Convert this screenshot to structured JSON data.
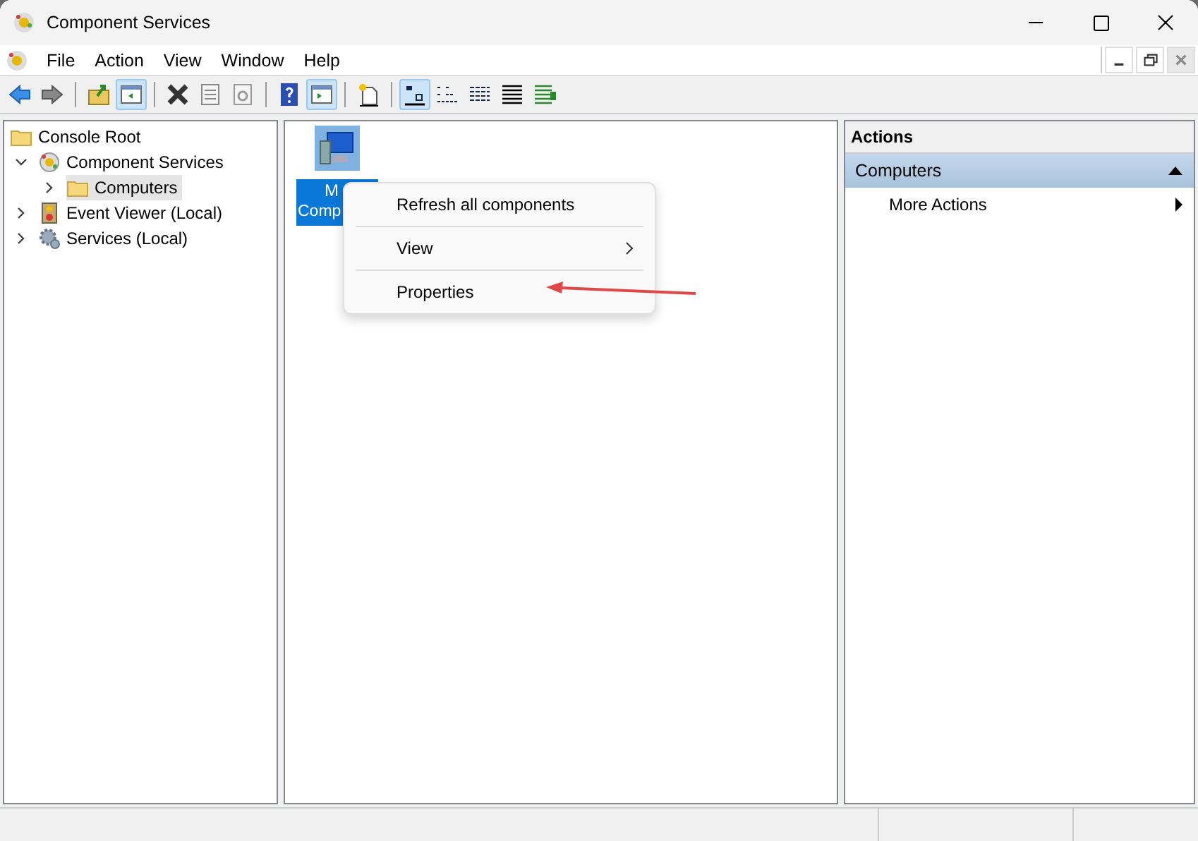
{
  "window": {
    "title": "Component Services"
  },
  "menu_bar": [
    "File",
    "Action",
    "View",
    "Window",
    "Help"
  ],
  "toolbar": [
    {
      "kind": "back",
      "pressed": false
    },
    {
      "kind": "forward",
      "pressed": false
    },
    {
      "kind": "sep"
    },
    {
      "kind": "up",
      "pressed": false
    },
    {
      "kind": "tree",
      "pressed": true
    },
    {
      "kind": "sep"
    },
    {
      "kind": "delete",
      "pressed": false
    },
    {
      "kind": "properties",
      "pressed": false
    },
    {
      "kind": "refresh",
      "pressed": false
    },
    {
      "kind": "sep"
    },
    {
      "kind": "help",
      "pressed": false
    },
    {
      "kind": "actionpane",
      "pressed": true
    },
    {
      "kind": "sep"
    },
    {
      "kind": "newwindow",
      "pressed": false
    },
    {
      "kind": "sep"
    },
    {
      "kind": "largeicons",
      "pressed": true
    },
    {
      "kind": "smallicons",
      "pressed": false
    },
    {
      "kind": "list",
      "pressed": false
    },
    {
      "kind": "details",
      "pressed": false
    },
    {
      "kind": "export",
      "pressed": false
    }
  ],
  "tree": [
    {
      "label": "Console Root",
      "kind": "folder",
      "selected": false,
      "children": [
        {
          "label": "Component Services",
          "kind": "component",
          "expanded": true,
          "selected": false,
          "children": [
            {
              "label": "Computers",
              "kind": "folder",
              "expanded": false,
              "selected": true
            }
          ]
        },
        {
          "label": "Event Viewer (Local)",
          "kind": "event",
          "expanded": false,
          "selected": false
        },
        {
          "label": "Services (Local)",
          "kind": "services",
          "expanded": false,
          "selected": false
        }
      ]
    }
  ],
  "content": {
    "items": [
      {
        "label_lines": [
          "M",
          "Comp"
        ],
        "selected": true
      }
    ]
  },
  "context_menu": [
    {
      "label": "Refresh all components",
      "submenu": false
    },
    {
      "label": "View",
      "submenu": true
    },
    {
      "label": "Properties",
      "submenu": false
    }
  ],
  "actions": {
    "title": "Actions",
    "sections": [
      {
        "title": "Computers",
        "expanded": true,
        "items": [
          {
            "label": "More Actions",
            "submenu": true
          }
        ]
      }
    ]
  }
}
